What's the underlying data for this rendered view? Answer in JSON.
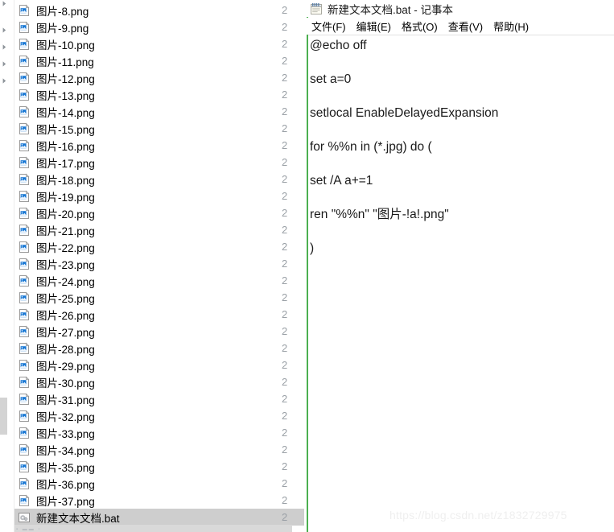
{
  "explorer": {
    "pane_divider": true,
    "tree_chevron_icon": "chevron-right-icon",
    "file_icon_png": "png-image-file-icon",
    "file_icon_bat": "batch-script-gears-icon",
    "date_column_value": "2",
    "files": [
      {
        "name": "图片-8.png",
        "type": "png",
        "selected": false,
        "date": "2"
      },
      {
        "name": "图片-9.png",
        "type": "png",
        "selected": false,
        "date": "2"
      },
      {
        "name": "图片-10.png",
        "type": "png",
        "selected": false,
        "date": "2"
      },
      {
        "name": "图片-11.png",
        "type": "png",
        "selected": false,
        "date": "2"
      },
      {
        "name": "图片-12.png",
        "type": "png",
        "selected": false,
        "date": "2"
      },
      {
        "name": "图片-13.png",
        "type": "png",
        "selected": false,
        "date": "2"
      },
      {
        "name": "图片-14.png",
        "type": "png",
        "selected": false,
        "date": "2"
      },
      {
        "name": "图片-15.png",
        "type": "png",
        "selected": false,
        "date": "2"
      },
      {
        "name": "图片-16.png",
        "type": "png",
        "selected": false,
        "date": "2"
      },
      {
        "name": "图片-17.png",
        "type": "png",
        "selected": false,
        "date": "2"
      },
      {
        "name": "图片-18.png",
        "type": "png",
        "selected": false,
        "date": "2"
      },
      {
        "name": "图片-19.png",
        "type": "png",
        "selected": false,
        "date": "2"
      },
      {
        "name": "图片-20.png",
        "type": "png",
        "selected": false,
        "date": "2"
      },
      {
        "name": "图片-21.png",
        "type": "png",
        "selected": false,
        "date": "2"
      },
      {
        "name": "图片-22.png",
        "type": "png",
        "selected": false,
        "date": "2"
      },
      {
        "name": "图片-23.png",
        "type": "png",
        "selected": false,
        "date": "2"
      },
      {
        "name": "图片-24.png",
        "type": "png",
        "selected": false,
        "date": "2"
      },
      {
        "name": "图片-25.png",
        "type": "png",
        "selected": false,
        "date": "2"
      },
      {
        "name": "图片-26.png",
        "type": "png",
        "selected": false,
        "date": "2"
      },
      {
        "name": "图片-27.png",
        "type": "png",
        "selected": false,
        "date": "2"
      },
      {
        "name": "图片-28.png",
        "type": "png",
        "selected": false,
        "date": "2"
      },
      {
        "name": "图片-29.png",
        "type": "png",
        "selected": false,
        "date": "2"
      },
      {
        "name": "图片-30.png",
        "type": "png",
        "selected": false,
        "date": "2"
      },
      {
        "name": "图片-31.png",
        "type": "png",
        "selected": false,
        "date": "2"
      },
      {
        "name": "图片-32.png",
        "type": "png",
        "selected": false,
        "date": "2"
      },
      {
        "name": "图片-33.png",
        "type": "png",
        "selected": false,
        "date": "2"
      },
      {
        "name": "图片-34.png",
        "type": "png",
        "selected": false,
        "date": "2"
      },
      {
        "name": "图片-35.png",
        "type": "png",
        "selected": false,
        "date": "2"
      },
      {
        "name": "图片-36.png",
        "type": "png",
        "selected": false,
        "date": "2"
      },
      {
        "name": "图片-37.png",
        "type": "png",
        "selected": false,
        "date": "2"
      },
      {
        "name": "新建文本文档.bat",
        "type": "bat",
        "selected": true,
        "date": "2"
      }
    ]
  },
  "notepad": {
    "title": "新建文本文档.bat - 记事本",
    "title_icon": "notepad-icon",
    "menu": [
      {
        "label": "文件(F)",
        "name": "menu-file"
      },
      {
        "label": "编辑(E)",
        "name": "menu-edit"
      },
      {
        "label": "格式(O)",
        "name": "menu-format"
      },
      {
        "label": "查看(V)",
        "name": "menu-view"
      },
      {
        "label": "帮助(H)",
        "name": "menu-help"
      }
    ],
    "script_lines": [
      "@echo off",
      "set a=0",
      "setlocal EnableDelayedExpansion",
      "for %%n in (*.jpg) do (",
      "set /A a+=1",
      "ren \"%%n\" \"图片-!a!.png\"",
      ")"
    ],
    "caret_visible": true,
    "accent_border_color": "#4caf50"
  },
  "watermark": {
    "text": "https://blog.csdn.net/z1832729975"
  }
}
